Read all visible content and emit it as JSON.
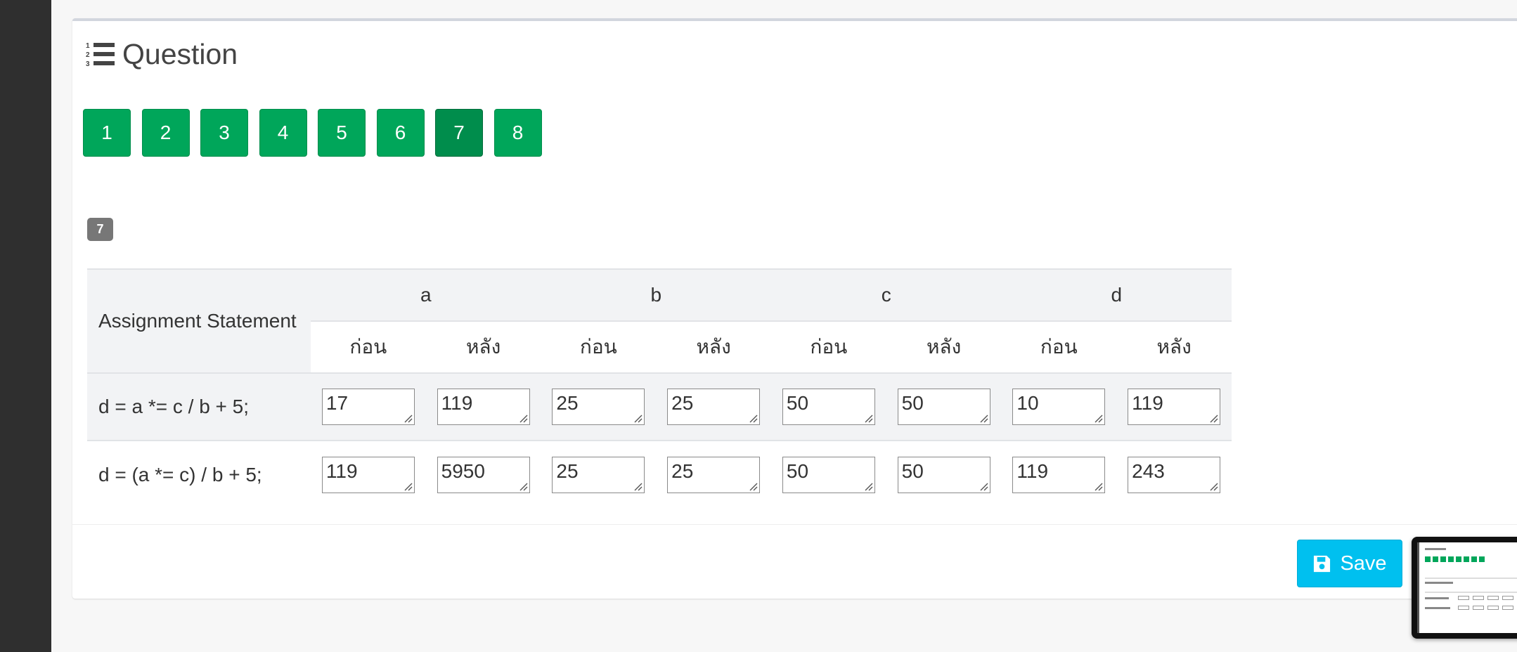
{
  "panel": {
    "title": "Question"
  },
  "question_nav": {
    "buttons": [
      "1",
      "2",
      "3",
      "4",
      "5",
      "6",
      "7",
      "8"
    ],
    "active": "7"
  },
  "question_badge": "7",
  "table": {
    "statement_header": "Assignment Statement",
    "variables": [
      "a",
      "b",
      "c",
      "d"
    ],
    "sub_headers": [
      "ก่อน",
      "หลัง",
      "ก่อน",
      "หลัง",
      "ก่อน",
      "หลัง",
      "ก่อน",
      "หลัง"
    ],
    "rows": [
      {
        "statement": "d = a *= c / b + 5;",
        "values": [
          "17",
          "119",
          "25",
          "25",
          "50",
          "50",
          "10",
          "119"
        ]
      },
      {
        "statement": "d = (a *= c) / b + 5;",
        "values": [
          "119",
          "5950",
          "25",
          "25",
          "50",
          "50",
          "119",
          "243"
        ]
      }
    ]
  },
  "footer": {
    "save_label": "Save"
  },
  "colors": {
    "nav_button": "#00a65a",
    "nav_button_active": "#008d4c",
    "save_button": "#00c0ef",
    "badge": "#777777",
    "sidebar": "#2f2f2f"
  },
  "icons": {
    "title_icon": "list-ol-icon",
    "save_icon": "floppy-disk-icon"
  }
}
